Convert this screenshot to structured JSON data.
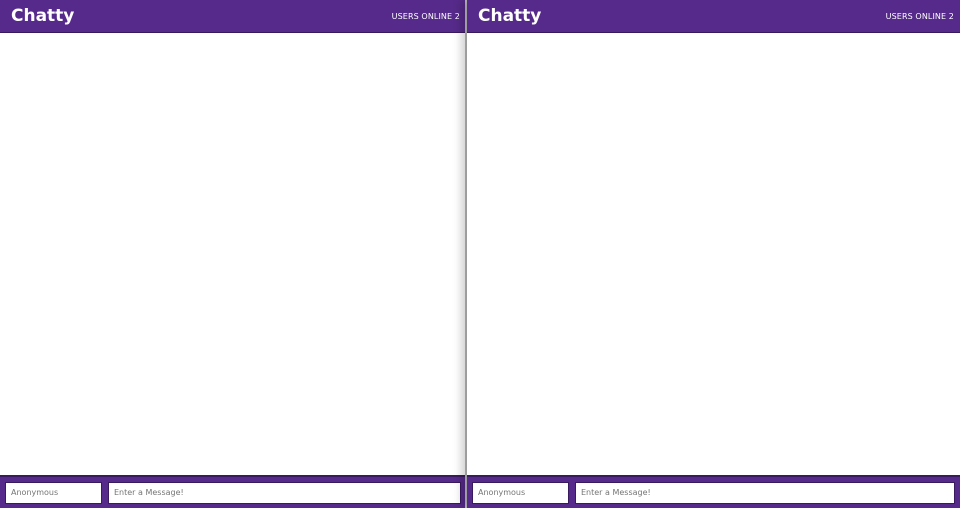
{
  "windows": [
    {
      "title": "Chatty",
      "users_online": "USERS ONLINE 2",
      "username_placeholder": "Anonymous",
      "message_placeholder": "Enter a Message!"
    },
    {
      "title": "Chatty",
      "users_online": "USERS ONLINE 2",
      "username_placeholder": "Anonymous",
      "message_placeholder": "Enter a Message!"
    }
  ],
  "colors": {
    "brand": "#562a8a"
  }
}
